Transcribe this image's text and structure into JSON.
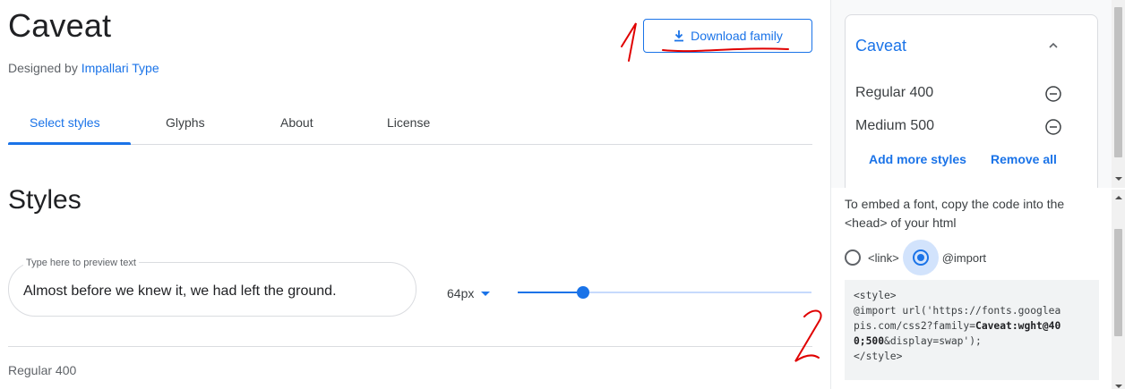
{
  "family": {
    "name": "Caveat",
    "designed_by_prefix": "Designed by",
    "designer": "Impallari Type"
  },
  "download_button": {
    "label": "Download family"
  },
  "tabs": [
    {
      "label": "Select styles",
      "active": true
    },
    {
      "label": "Glyphs",
      "active": false
    },
    {
      "label": "About",
      "active": false
    },
    {
      "label": "License",
      "active": false
    }
  ],
  "styles_section": {
    "title": "Styles",
    "preview_label": "Type here to preview text",
    "preview_value": "Almost before we knew it, we had left the ground.",
    "size_value": "64px",
    "size_slider_fraction": 0.2,
    "first_style": "Regular 400"
  },
  "panel": {
    "family_title": "Caveat",
    "selected_styles": [
      "Regular 400",
      "Medium 500"
    ],
    "add_more": "Add more styles",
    "remove_all": "Remove all",
    "embed_text": "To embed a font, copy the code into the <head> of your html",
    "embed_options": [
      {
        "label": "<link>",
        "checked": false
      },
      {
        "label": "@import",
        "checked": true
      }
    ],
    "code": {
      "line1": "<style>",
      "line2": "@import url('https://fonts.googlea",
      "line3_pre": "pis.com/css2?family=",
      "line3_bold": "Caveat:wght@40",
      "line4_bold": "0;500",
      "line4_post": "&display=swap');",
      "line5": "</style>"
    }
  },
  "annotations": [
    "1",
    "2"
  ],
  "colors": {
    "accent": "#1a73e8",
    "annotation": "#e00000"
  },
  "icons": [
    "download-icon",
    "chevron-up-icon",
    "remove-circle-icon",
    "dropdown-caret-icon"
  ]
}
